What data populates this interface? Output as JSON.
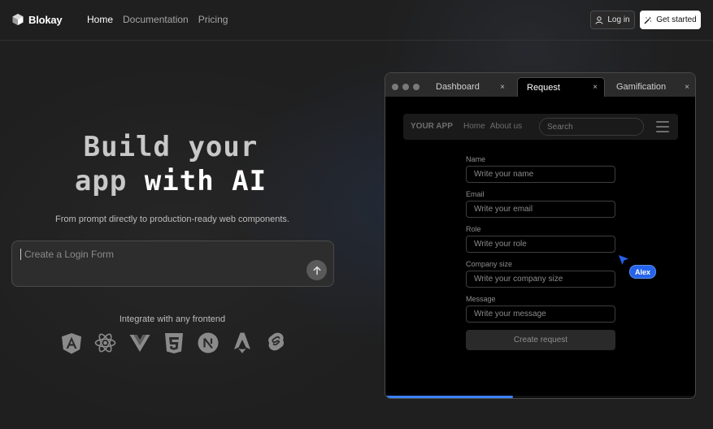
{
  "brand": {
    "name": "Blokay"
  },
  "nav": {
    "links": [
      {
        "label": "Home",
        "active": true
      },
      {
        "label": "Documentation",
        "active": false
      },
      {
        "label": "Pricing",
        "active": false
      }
    ],
    "login_label": "Log in",
    "start_label": "Get started"
  },
  "hero": {
    "title_line1": "Build your",
    "title_line2_dim": "app",
    "title_line2_bright": "with AI",
    "subtitle": "From prompt directly to production-ready web components.",
    "prompt_placeholder": "Create a Login Form",
    "integrate_label": "Integrate with any frontend",
    "frameworks": [
      "angular-icon",
      "react-icon",
      "vue-icon",
      "html5-icon",
      "nextjs-icon",
      "astro-icon",
      "svelte-icon"
    ]
  },
  "browser": {
    "tabs": [
      {
        "label": "Dashboard",
        "close": "×",
        "active": false
      },
      {
        "label": "Request",
        "close": "×",
        "active": true
      },
      {
        "label": "Gamification",
        "close": "×",
        "active": false
      }
    ],
    "app_nav": {
      "brand": "YOUR APP",
      "link_home": "Home",
      "link_about": "About us",
      "search_placeholder": "Search"
    },
    "form": {
      "fields": [
        {
          "label": "Name",
          "placeholder": "Write your name"
        },
        {
          "label": "Email",
          "placeholder": "Write your email"
        },
        {
          "label": "Role",
          "placeholder": "Write your role"
        },
        {
          "label": "Company size",
          "placeholder": "Write your company size"
        },
        {
          "label": "Message",
          "placeholder": "Write your message"
        }
      ],
      "submit_label": "Create request"
    },
    "progress": 0.41
  },
  "cursor": {
    "name": "Alex",
    "color": "#2563eb"
  },
  "colors": {
    "accent": "#3b82f6",
    "background": "#1f1f1f"
  }
}
